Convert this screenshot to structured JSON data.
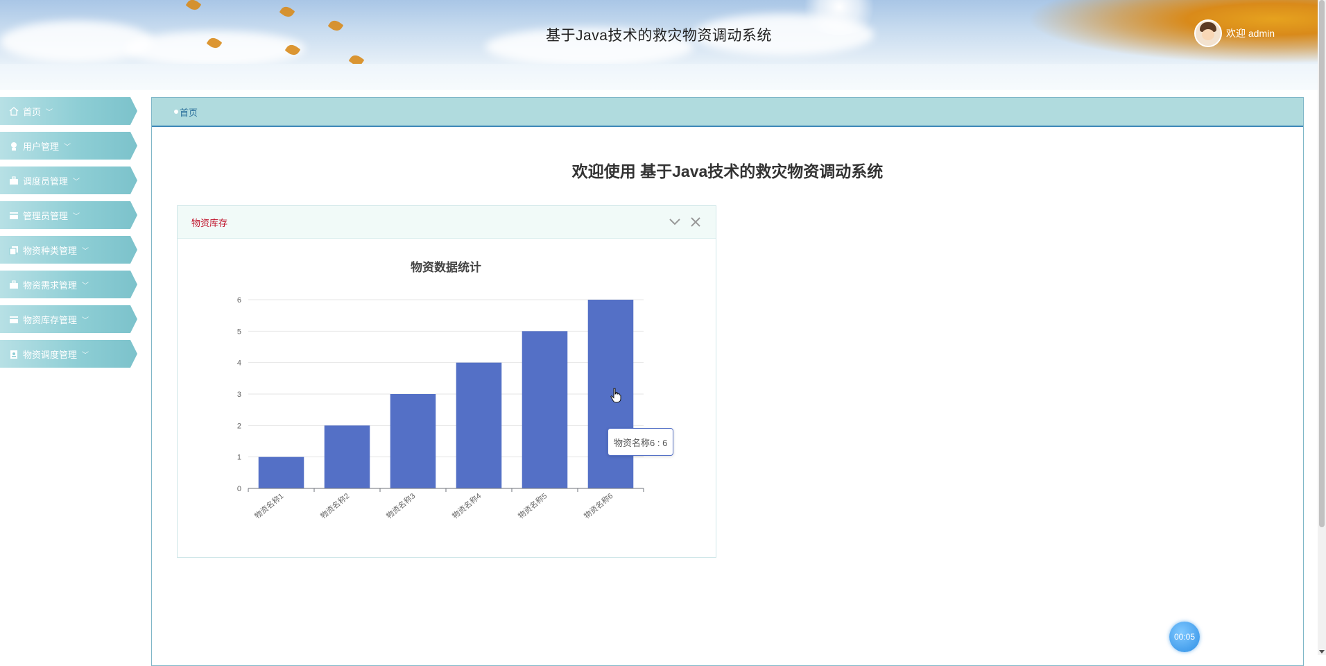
{
  "header": {
    "app_title": "基于Java技术的救灾物资调动系统",
    "welcome_text": "欢迎 admin"
  },
  "sidebar": {
    "items": [
      {
        "label": "首页",
        "icon": "home-icon"
      },
      {
        "label": "用户管理",
        "icon": "user-icon"
      },
      {
        "label": "调度员管理",
        "icon": "briefcase-icon"
      },
      {
        "label": "管理员管理",
        "icon": "card-icon"
      },
      {
        "label": "物资种类管理",
        "icon": "copy-icon"
      },
      {
        "label": "物资需求管理",
        "icon": "briefcase-icon"
      },
      {
        "label": "物资库存管理",
        "icon": "card-icon"
      },
      {
        "label": "物资调度管理",
        "icon": "id-badge-icon"
      }
    ]
  },
  "breadcrumb": {
    "current": "首页"
  },
  "main": {
    "welcome_title": "欢迎使用 基于Java技术的救灾物资调动系统"
  },
  "card": {
    "title": "物资库存"
  },
  "tooltip": {
    "text": "物资名称6 : 6"
  },
  "timer": {
    "text": "00:05"
  },
  "colors": {
    "bar": "#5470c6",
    "card_title": "#c0132b",
    "sidebar": "#8ccdd4",
    "breadcrumb_bar": "#b0dbde"
  },
  "chart_data": {
    "type": "bar",
    "title": "物资数据统计",
    "categories": [
      "物资名称1",
      "物资名称2",
      "物资名称3",
      "物资名称4",
      "物资名称5",
      "物资名称6"
    ],
    "values": [
      1,
      2,
      3,
      4,
      5,
      6
    ],
    "xlabel": "",
    "ylabel": "",
    "ylim": [
      0,
      6
    ],
    "yticks": [
      0,
      1,
      2,
      3,
      4,
      5,
      6
    ],
    "grid": true,
    "legend": "none"
  }
}
